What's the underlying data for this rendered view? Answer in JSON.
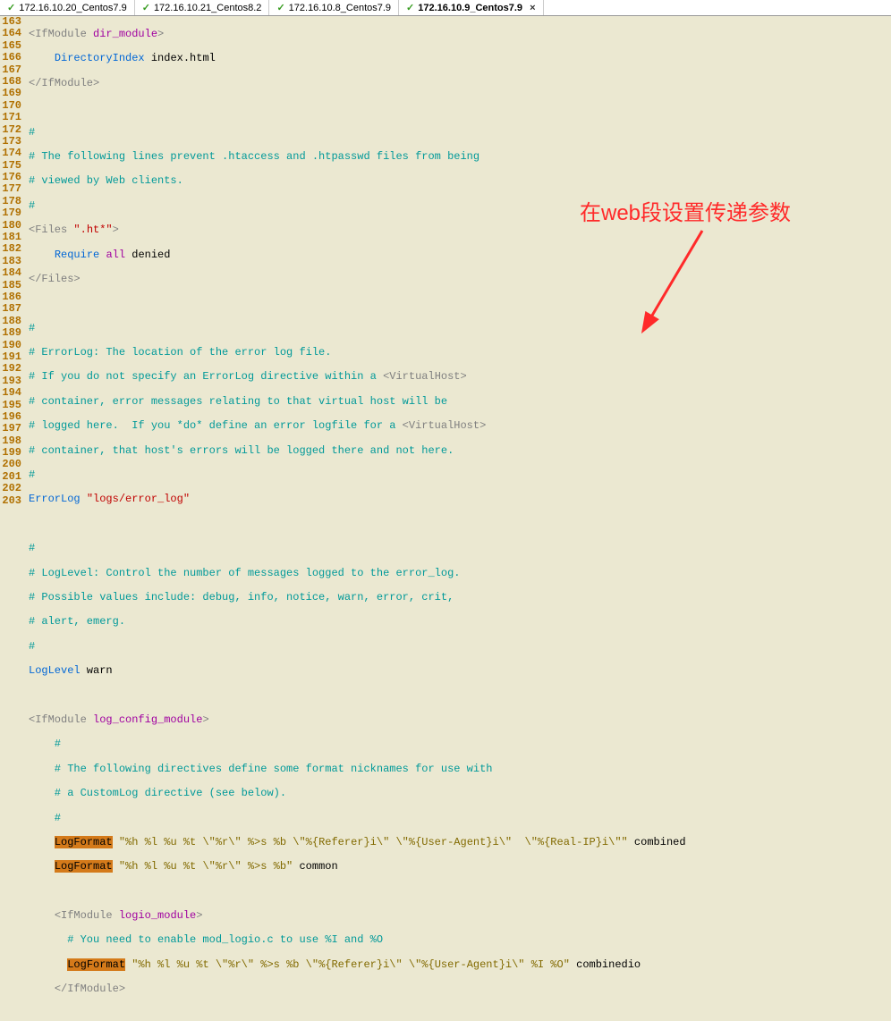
{
  "tabs": {
    "items": [
      {
        "label": "172.16.10.20_Centos7.9",
        "active": false
      },
      {
        "label": "172.16.10.21_Centos8.2",
        "active": false
      },
      {
        "label": "172.16.10.8_Centos7.9",
        "active": false
      },
      {
        "label": "172.16.10.9_Centos7.9",
        "active": true
      }
    ]
  },
  "annotation": {
    "text": "在web段设置传递参数"
  },
  "gutter": {
    "start": 163,
    "end": 203
  },
  "code": {
    "l163": {
      "a": "<IfModule ",
      "b": "dir_module",
      "c": ">"
    },
    "l164": {
      "a": "    ",
      "b": "DirectoryIndex",
      "c": " index.html"
    },
    "l165": {
      "a": "</IfModule>"
    },
    "l166": {
      "a": ""
    },
    "l167": {
      "a": "#"
    },
    "l168": {
      "a": "# The following lines prevent .htaccess and .htpasswd files from being"
    },
    "l169": {
      "a": "# viewed by Web clients."
    },
    "l170": {
      "a": "#"
    },
    "l171": {
      "a": "<Files ",
      "b": "\".ht*\"",
      "c": ">"
    },
    "l172": {
      "a": "    ",
      "b": "Require",
      "sp": " ",
      "c": "all",
      "d": " denied"
    },
    "l173": {
      "a": "</Files>"
    },
    "l174": {
      "a": ""
    },
    "l175": {
      "a": "#"
    },
    "l176": {
      "a": "# ErrorLog: The location of the error log file."
    },
    "l177": {
      "a": "# If you do not specify an ErrorLog directive within a ",
      "b": "<VirtualHost>"
    },
    "l178": {
      "a": "# container, error messages relating to that virtual host will be"
    },
    "l179": {
      "a": "# logged here.  If you *do* define an error logfile for a ",
      "b": "<VirtualHost>"
    },
    "l180": {
      "a": "# container, that host's errors will be logged there and not here."
    },
    "l181": {
      "a": "#"
    },
    "l182": {
      "a": "ErrorLog",
      "sp": " ",
      "b": "\"logs/error_log\""
    },
    "l183": {
      "a": ""
    },
    "l184": {
      "a": "#"
    },
    "l185": {
      "a": "# LogLevel: Control the number of messages logged to the error_log."
    },
    "l186": {
      "a": "# Possible values include: debug, info, notice, warn, error, crit,"
    },
    "l187": {
      "a": "# alert, emerg."
    },
    "l188": {
      "a": "#"
    },
    "l189": {
      "a": "LogLevel",
      "b": " warn"
    },
    "l190": {
      "a": ""
    },
    "l191": {
      "a": "<IfModule ",
      "b": "log_config_module",
      "c": ">"
    },
    "l192": {
      "a": "    #"
    },
    "l193": {
      "a": "    # The following directives define some format nicknames for use with"
    },
    "l194": {
      "a": "    # a CustomLog directive (see below)."
    },
    "l195": {
      "a": "    #"
    },
    "l196": {
      "pre": "    ",
      "hl": "LogFormat",
      "sp": " ",
      "a": "\"%h %l %u %t \\\"%r\\\" %>s %b \\\"%{Referer}i\\\" \\\"%{User-Agent}i\\\"  \\\"%{Real-IP}i\\\"\"",
      "b": " combined"
    },
    "l197": {
      "pre": "    ",
      "hl": "LogFormat",
      "sp": " ",
      "a": "\"%h %l %u %t \\\"%r\\\" %>s %b\"",
      "b": " common"
    },
    "l198": {
      "a": ""
    },
    "l199": {
      "a": "    ",
      "b": "<IfModule ",
      "c": "logio_module",
      "d": ">"
    },
    "l200": {
      "a": "      # You need to enable mod_logio.c to use %I and %O"
    },
    "l201": {
      "pre": "      ",
      "hl": "LogFormat",
      "sp": " ",
      "a": "\"%h %l %u %t \\\"%r\\\" %>s %b \\\"%{Referer}i\\\" \\\"%{User-Agent}i\\\" %I %O\"",
      "b": " combinedio"
    },
    "l202": {
      "a": "    ",
      "b": "</IfModule>"
    },
    "l203": {
      "a": ""
    }
  }
}
